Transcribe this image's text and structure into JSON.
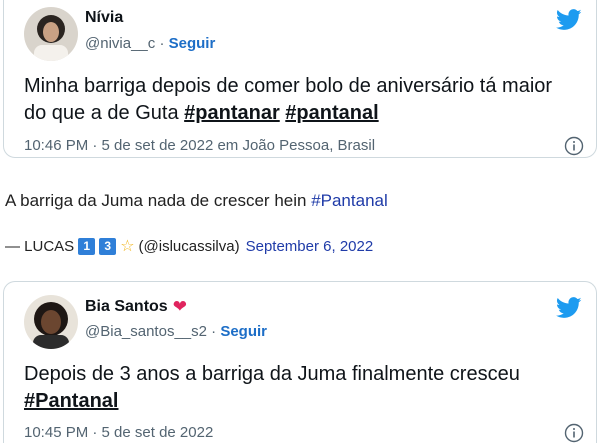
{
  "tweet1": {
    "name": "Nívia",
    "handle": "@nivia__c",
    "separator": "·",
    "follow_label": "Seguir",
    "text_main": "Minha barriga depois de comer bolo de aniversário tá maior do que a de Guta ",
    "hashtag1": "#pantanar",
    "hashtag2": "#pantanal",
    "meta": "10:46 PM · 5 de set de 2022 em João Pessoa, Brasil"
  },
  "blockquote": {
    "text": "A barriga da Juma nada de crescer hein ",
    "hashtag": "#Pantanal",
    "author_prefix": "— LUCAS",
    "badge1": "1",
    "badge2": "3",
    "star": "☆",
    "handle": "(@islucassilva)",
    "date": "September 6, 2022"
  },
  "tweet2": {
    "name": "Bia Santos",
    "heart": "❤",
    "handle": "@Bia_santos__s2",
    "separator": "·",
    "follow_label": "Seguir",
    "text_main": "Depois de 3 anos a barriga da Juma finalmente cresceu ",
    "hashtag": "#Pantanal",
    "meta": "10:45 PM · 5 de set de 2022"
  },
  "colors": {
    "twitter_blue": "#1d9bf0",
    "link_blue": "#1f3ba8",
    "heart_red": "#e0245e"
  },
  "icons": [
    "twitter-bird-icon",
    "info-icon",
    "avatar"
  ]
}
